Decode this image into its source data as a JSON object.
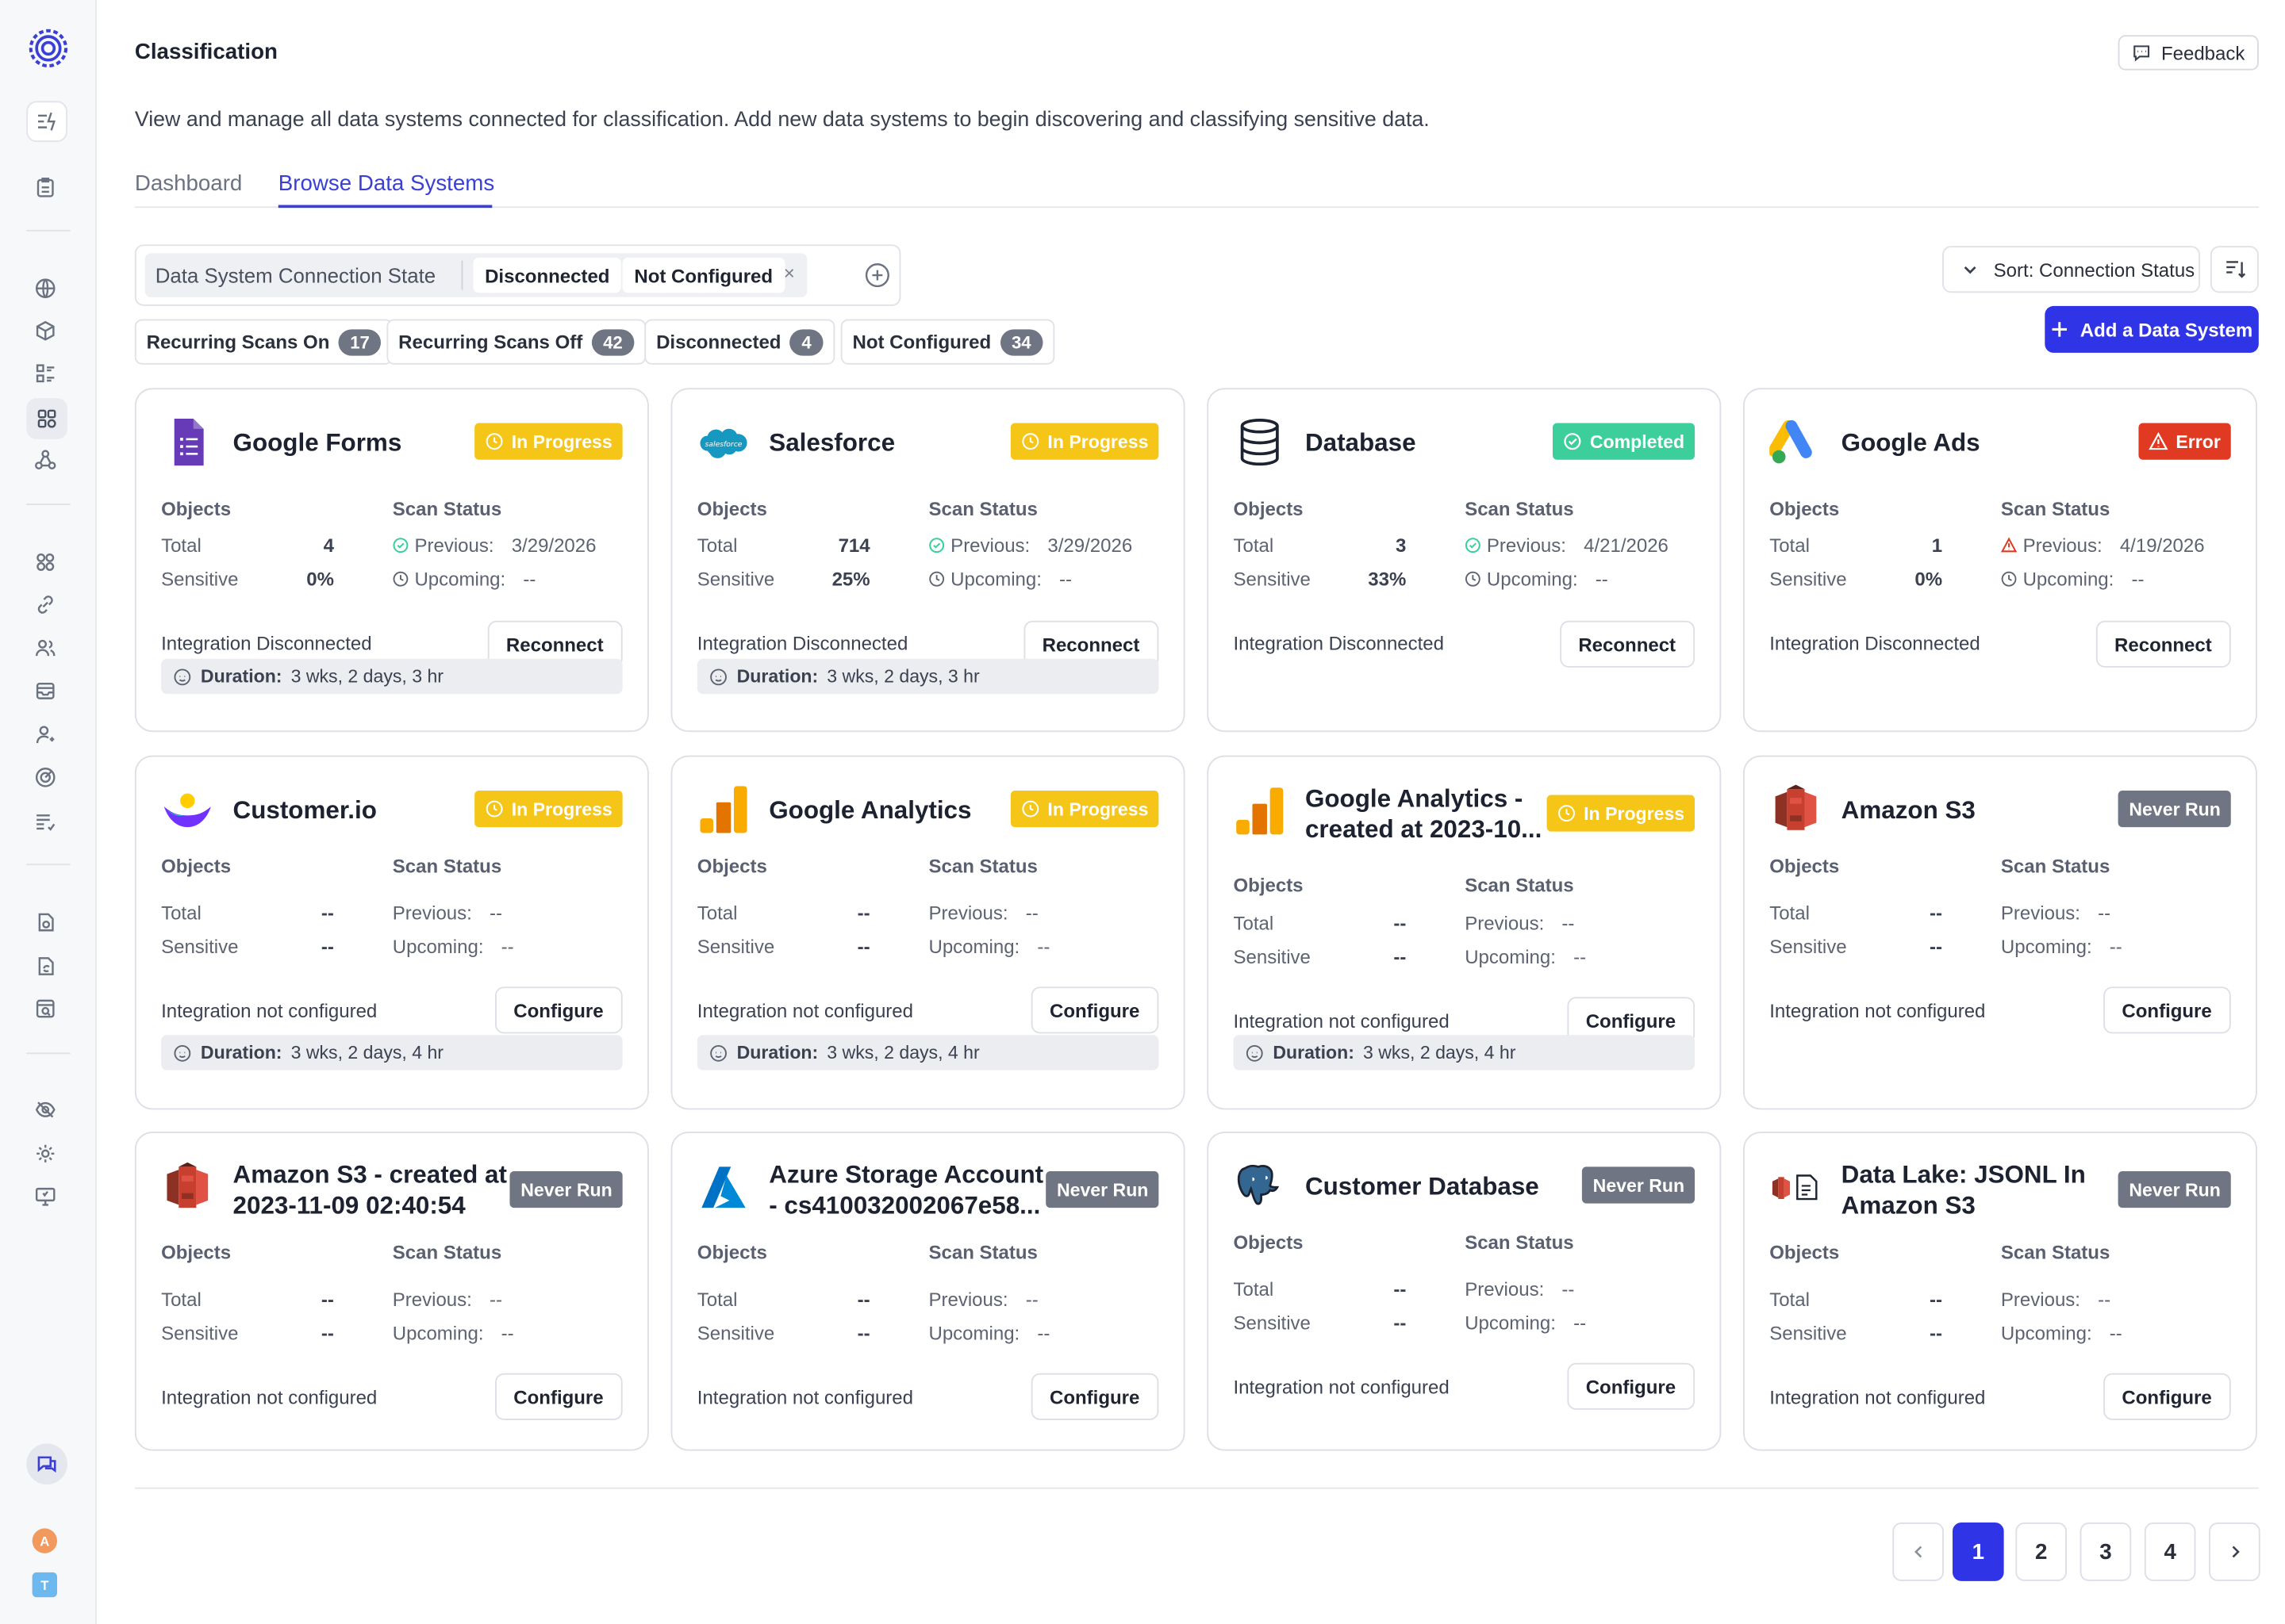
{
  "header": {
    "title": "Classification",
    "feedback_label": "Feedback",
    "description": "View and manage all data systems connected for classification. Add new data systems to begin discovering and classifying sensitive data."
  },
  "tabs": [
    {
      "label": "Dashboard",
      "active": false
    },
    {
      "label": "Browse Data Systems",
      "active": true
    }
  ],
  "filter": {
    "label": "Data System Connection State",
    "chips": [
      "Disconnected",
      "Not Configured"
    ],
    "remove_glyph": "×"
  },
  "stats": [
    {
      "label": "Recurring Scans On",
      "count": "17"
    },
    {
      "label": "Recurring Scans Off",
      "count": "42"
    },
    {
      "label": "Disconnected",
      "count": "4"
    },
    {
      "label": "Not Configured",
      "count": "34"
    }
  ],
  "sort": {
    "label": "Sort: Connection Status"
  },
  "add_button": {
    "label": "Add a Data System"
  },
  "labels": {
    "objects": "Objects",
    "scan_status": "Scan Status",
    "total": "Total",
    "sensitive": "Sensitive",
    "previous": "Previous:",
    "upcoming": "Upcoming:",
    "duration": "Duration:"
  },
  "cards": [
    {
      "name": "Google Forms",
      "logo": "google-forms-logo",
      "badge": "In Progress",
      "total": "4",
      "sensitive": "0%",
      "previous": "3/29/2026",
      "upcoming": "--",
      "integration": "Integration Disconnected",
      "action": "Reconnect",
      "duration": "3 wks, 2 days, 3 hr"
    },
    {
      "name": "Salesforce",
      "logo": "salesforce-logo",
      "badge": "In Progress",
      "total": "714",
      "sensitive": "25%",
      "previous": "3/29/2026",
      "upcoming": "--",
      "integration": "Integration Disconnected",
      "action": "Reconnect",
      "duration": "3 wks, 2 days, 3 hr"
    },
    {
      "name": "Database",
      "logo": "database-logo",
      "badge": "Completed",
      "total": "3",
      "sensitive": "33%",
      "previous": "4/21/2026",
      "upcoming": "--",
      "integration": "Integration Disconnected",
      "action": "Reconnect",
      "duration": ""
    },
    {
      "name": "Google Ads",
      "logo": "google-ads-logo",
      "badge": "Error",
      "total": "1",
      "sensitive": "0%",
      "previous": "4/19/2026",
      "upcoming": "--",
      "integration": "Integration Disconnected",
      "action": "Reconnect",
      "duration": ""
    },
    {
      "name": "Customer.io",
      "logo": "customerio-logo",
      "badge": "In Progress",
      "total": "--",
      "sensitive": "--",
      "previous": "--",
      "upcoming": "--",
      "integration": "Integration not configured",
      "action": "Configure",
      "duration": "3 wks, 2 days, 4 hr"
    },
    {
      "name": "Google Analytics",
      "logo": "google-analytics-logo",
      "badge": "In Progress",
      "total": "--",
      "sensitive": "--",
      "previous": "--",
      "upcoming": "--",
      "integration": "Integration not configured",
      "action": "Configure",
      "duration": "3 wks, 2 days, 4 hr"
    },
    {
      "name": "Google Analytics - created at 2023-10...",
      "logo": "google-analytics-logo",
      "badge": "In Progress",
      "total": "--",
      "sensitive": "--",
      "previous": "--",
      "upcoming": "--",
      "integration": "Integration not configured",
      "action": "Configure",
      "duration": "3 wks, 2 days, 4 hr"
    },
    {
      "name": "Amazon S3",
      "logo": "amazon-s3-logo",
      "badge": "Never Run",
      "total": "--",
      "sensitive": "--",
      "previous": "--",
      "upcoming": "--",
      "integration": "Integration not configured",
      "action": "Configure",
      "duration": ""
    },
    {
      "name": "Amazon S3 - created at 2023-11-09 02:40:54",
      "logo": "amazon-s3-logo",
      "badge": "Never Run",
      "total": "--",
      "sensitive": "--",
      "previous": "--",
      "upcoming": "--",
      "integration": "Integration not configured",
      "action": "Configure",
      "duration": ""
    },
    {
      "name": "Azure Storage Account - cs410032002067e58...",
      "logo": "azure-logo",
      "badge": "Never Run",
      "total": "--",
      "sensitive": "--",
      "previous": "--",
      "upcoming": "--",
      "integration": "Integration not configured",
      "action": "Configure",
      "duration": ""
    },
    {
      "name": "Customer Database",
      "logo": "postgres-logo",
      "badge": "Never Run",
      "total": "--",
      "sensitive": "--",
      "previous": "--",
      "upcoming": "--",
      "integration": "Integration not configured",
      "action": "Configure",
      "duration": ""
    },
    {
      "name": "Data Lake: JSONL In Amazon S3",
      "logo": "data-lake-s3-logo",
      "badge": "Never Run",
      "total": "--",
      "sensitive": "--",
      "previous": "--",
      "upcoming": "--",
      "integration": "Integration not configured",
      "action": "Configure",
      "duration": ""
    }
  ],
  "pagination": {
    "pages": [
      "1",
      "2",
      "3",
      "4"
    ],
    "current": "1"
  },
  "user": {
    "avatar_initial": "A",
    "workspace_initial": "T"
  },
  "colors": {
    "accent": "#2f35e6",
    "progress": "#f5c518",
    "completed": "#3ccf9c",
    "error": "#e03a22",
    "never_run": "#6f7582"
  }
}
